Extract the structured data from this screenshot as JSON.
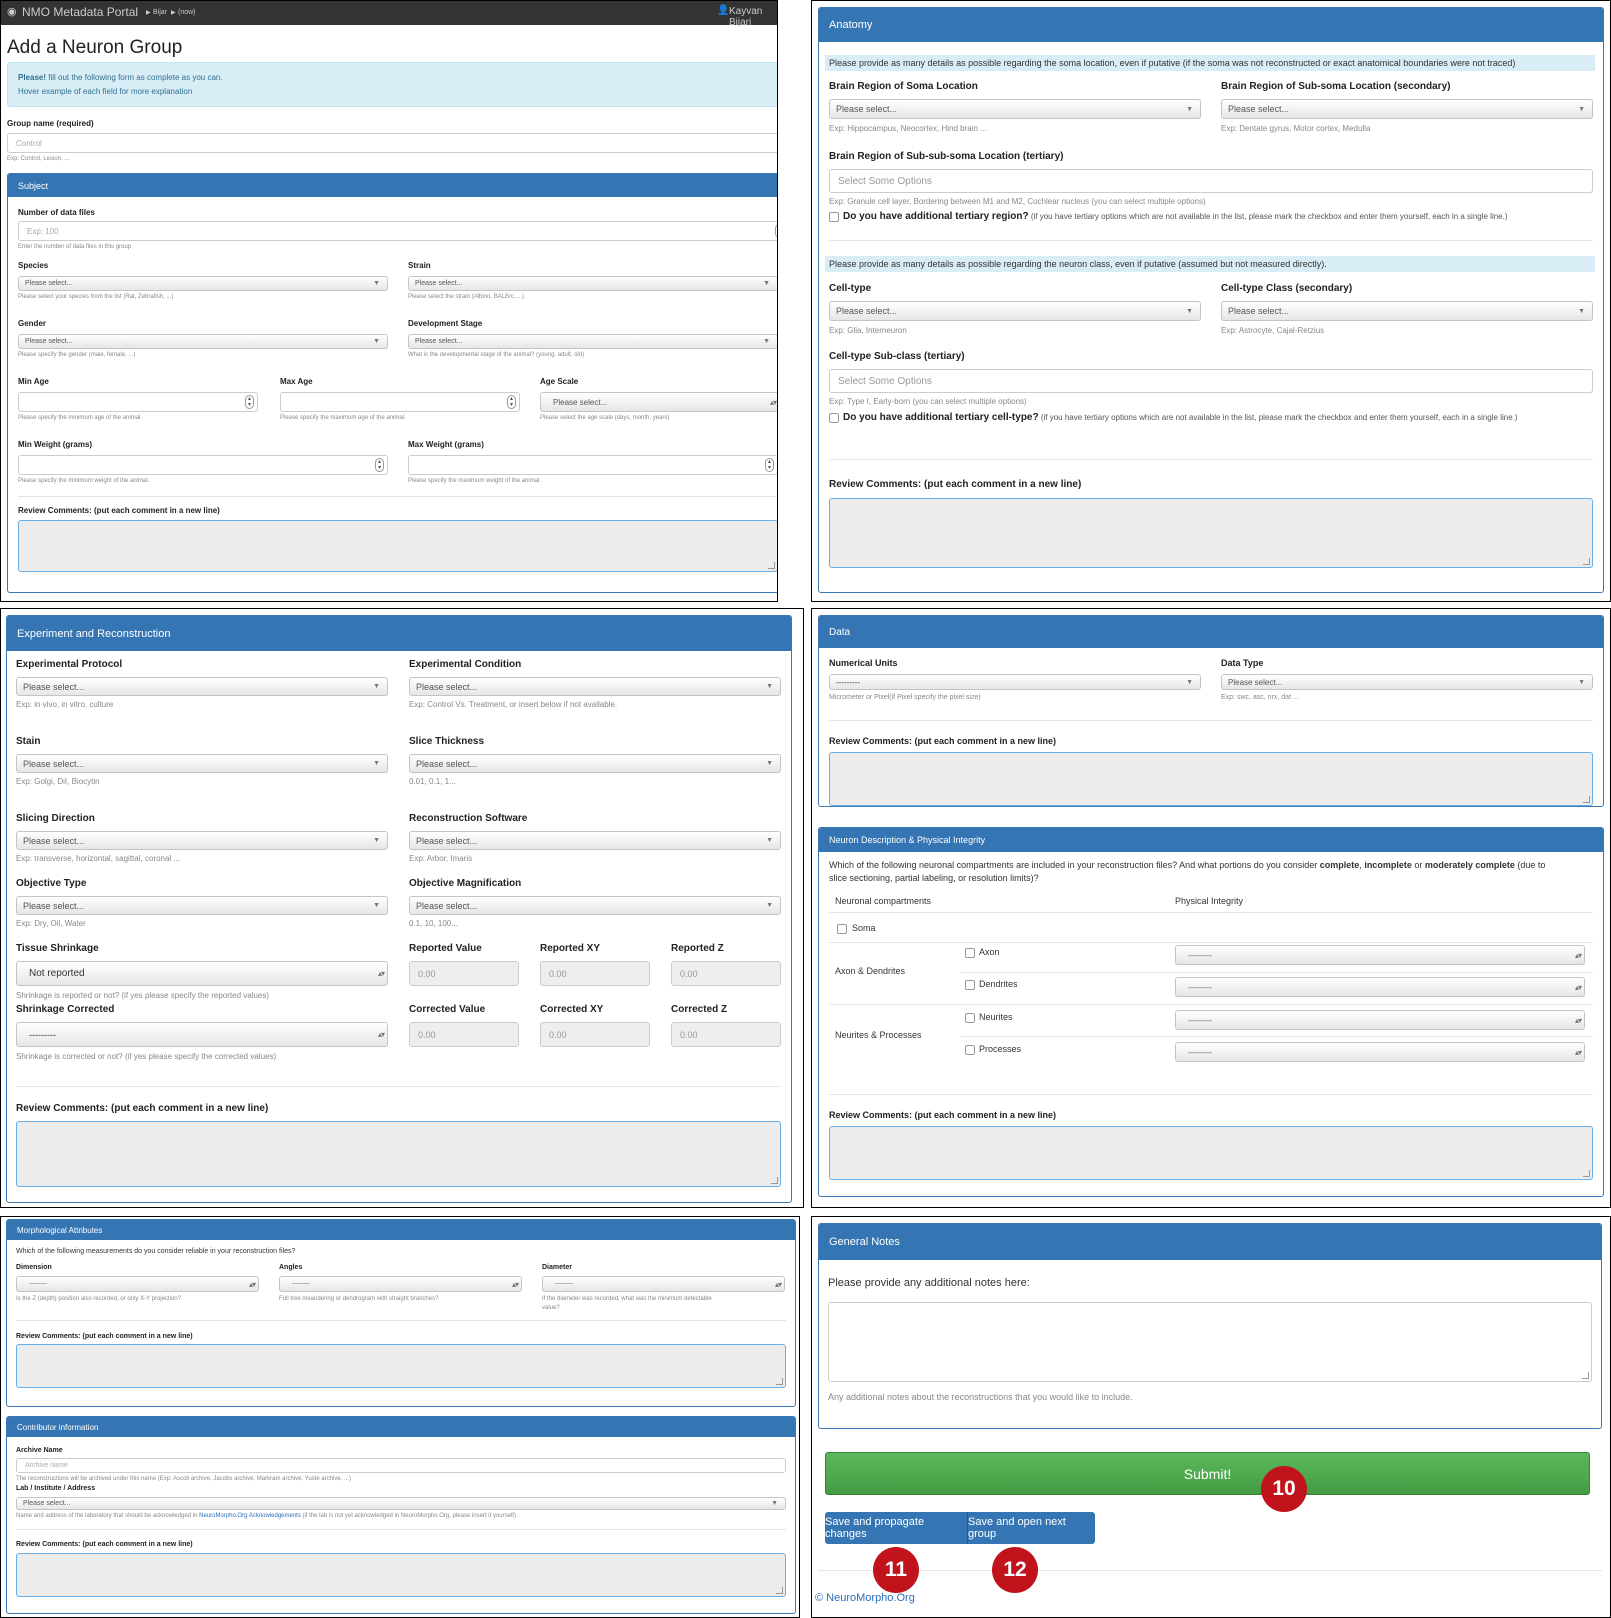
{
  "navbar": {
    "brand": "NMO Metadata Portal",
    "crumb1": "Bijar",
    "crumb2": "(now)",
    "user": "Kayvan Bijari"
  },
  "page": {
    "title": "Add a Neuron Group",
    "alert_strong": "Please!",
    "alert_text": " fill out the following form as complete as you can.",
    "alert_line2": "Hover example of each field for more explanation"
  },
  "group": {
    "label": "Group name (required)",
    "placeholder": "Control",
    "hint": "Exp: Control, Lesion, ..."
  },
  "common": {
    "please_select": "Please select...",
    "dashes": "---------",
    "zero": "0.00",
    "select_some": "Select Some Options",
    "review": "Review Comments: (put each comment in a new line)"
  },
  "subject": {
    "title": "Subject",
    "files_label": "Number of data files",
    "files_placeholder": "Exp: 100",
    "files_hint": "Enter the number of data files in this group",
    "species": "Species",
    "species_hint": "Please select your species from the list (Rat, Zebrafish, ...)",
    "strain": "Strain",
    "strain_hint": "Please select the strain (Albino, BALB/c, ...)",
    "gender": "Gender",
    "gender_hint": "Please specify the gender (male, female, ...)",
    "dev": "Development Stage",
    "dev_hint": "What is the developmental stage of the animal? (young, adult, old)",
    "min_age": "Min Age",
    "min_age_hint": "Please specify the minimum age of the animal.",
    "max_age": "Max Age",
    "max_age_hint": "Please specify the maximum age of the animal.",
    "age_scale": "Age Scale",
    "age_scale_hint": "Please select the age scale (days, month, years)",
    "min_w": "Min Weight (grams)",
    "min_w_hint": "Please specify the minimum weight of the animal.",
    "max_w": "Max Weight (grams)",
    "max_w_hint": "Please specify the maximum weight of the animal."
  },
  "anatomy": {
    "title": "Anatomy",
    "soma_note": "Please provide as many details as possible regarding the soma location, even if putative (if the soma was not reconstructed or exact anatomical boundaries were not traced)",
    "region1": "Brain Region of Soma Location",
    "region1_hint": "Exp: Hippocampus, Neocortex, Hind brain ...",
    "region2": "Brain Region of Sub-soma Location (secondary)",
    "region2_hint": "Exp: Dentate gyrus, Motor cortex, Medulla",
    "region3": "Brain Region of Sub-sub-soma Location (tertiary)",
    "region3_hint": "Exp: Granule cell layer, Bordering between M1 and M2, Cochlear nucleus (you can select multiple options)",
    "add_region_q": "Do you have additional tertiary region?",
    "add_region_note": " (if you have tertiary options which are not available in the list, please mark the checkbox and enter them yourself, each in a single line.)",
    "class_note": "Please provide as many details as possible regarding the neuron class, even if putative (assumed but not measured directly).",
    "cell": "Cell-type",
    "cell_hint": "Exp: Glia, Interneuron",
    "cell2": "Cell-type Class (secondary)",
    "cell2_hint": "Exp: Astrocyte, Cajal-Retzius",
    "cell3": "Cell-type Sub-class (tertiary)",
    "cell3_hint": "Exp: Type I, Early-born (you can select multiple options)",
    "add_cell_q": "Do you have additional tertiary cell-type?",
    "add_cell_note": " (if you have tertiary options which are not available in the list, please mark the checkbox and enter them yourself, each in a single line.)"
  },
  "experiment": {
    "title": "Experiment and Reconstruction",
    "protocol": "Experimental Protocol",
    "protocol_hint": "Exp: in vivo, in vitro, culture",
    "condition": "Experimental Condition",
    "condition_hint": "Exp: Control Vs. Treatment, or insert below if not available.",
    "stain": "Stain",
    "stain_hint": "Exp: Golgi, DiI, Biocytin",
    "thickness": "Slice Thickness",
    "thickness_hint": "0.01, 0.1, 1...",
    "direction": "Slicing Direction",
    "direction_hint": "Exp: transverse, horizontal, sagittal, coronal ...",
    "software": "Reconstruction Software",
    "software_hint": "Exp: Arbor, Imaris",
    "objective": "Objective Type",
    "objective_hint": "Exp: Dry, Oil, Water",
    "magnification": "Objective Magnification",
    "magnification_hint": "0.1, 10, 100...",
    "shrinkage": "Tissue Shrinkage",
    "shrinkage_value": "Not reported",
    "shrinkage_hint": "Shrinkage is reported or not? (if yes please specify the reported values)",
    "rep_value": "Reported Value",
    "rep_xy": "Reported XY",
    "rep_z": "Reported Z",
    "corrected": "Shrinkage Corrected",
    "corrected_hint": "Shrinkage is corrected or not? (if yes please specify the corrected values)",
    "cor_value": "Corrected Value",
    "cor_xy": "Corrected XY",
    "cor_z": "Corrected Z"
  },
  "data": {
    "title": "Data",
    "units": "Numerical Units",
    "units_hint": "Micrometer or Pixel(if Pixel specify the pixel size)",
    "type": "Data Type",
    "type_hint": "Exp: swc, asc, nrx, dat ..."
  },
  "integrity": {
    "title": "Neuron Description & Physical Integrity",
    "q1": "Which of the following neuronal compartments are included in your reconstruction files? And what portions do you consider ",
    "complete": "complete",
    "comma": ", ",
    "incomplete": "incomplete",
    "or": " or ",
    "moderately": "moderately complete",
    "q1_tail": " (due to",
    "q2": "slice sectioning, partial labeling, or resolution limits)?",
    "col1": "Neuronal compartments",
    "col2": "Physical Integrity",
    "soma": "Soma",
    "axdend": "Axon & Dendrites",
    "axon": "Axon",
    "dendrites": "Dendrites",
    "neurproc": "Neurites & Processes",
    "neurites": "Neurites",
    "processes": "Processes"
  },
  "morph": {
    "title": "Morphological Attributes",
    "question": "Which of the following measurements do you consider reliable in your reconstruction files?",
    "dimension": "Dimension",
    "dimension_hint": "Is the Z (depth) position also recorded, or only X-Y projection?",
    "angles": "Angles",
    "angles_hint": "Full tree meandering or dendrogram with straight branches?",
    "diameter": "Diameter",
    "diameter_hint1": "If the diameter was recorded, what was the minimum detectable",
    "diameter_hint2": "value?"
  },
  "contributor": {
    "title": "Contributor information",
    "archive": "Archive Name",
    "archive_placeholder": "Archive name",
    "archive_hint": "The reconstructions will be archived under this name (Exp: Ascoli archive, Jacobs archive, Markram archive, Yuste archive, ...)",
    "lab": "Lab / Institute / Address",
    "lab_hint1": "Name and address of the laboratory that should be acknowledged in ",
    "lab_link": "NeuroMorpho.Org Acknowledgements",
    "lab_hint2": " (if the lab is not yet acknowledged in NeuroMorpho.Org, please insert it yourself)"
  },
  "notes": {
    "title": "General Notes",
    "prompt": "Please provide any additional notes here:",
    "hint": "Any additional notes about the reconstructions that you would like to include."
  },
  "actions": {
    "submit": "Submit!",
    "propagate": "Save and propagate changes",
    "next": "Save and open next group",
    "footer": "© NeuroMorpho.Org"
  },
  "callouts": {
    "submit": "10",
    "propagate": "11",
    "next": "12"
  },
  "colors": {
    "panel_header": "#3575b3",
    "submit": "#4cae4c",
    "alert": "#d9edf7",
    "callout": "#c0131b"
  }
}
